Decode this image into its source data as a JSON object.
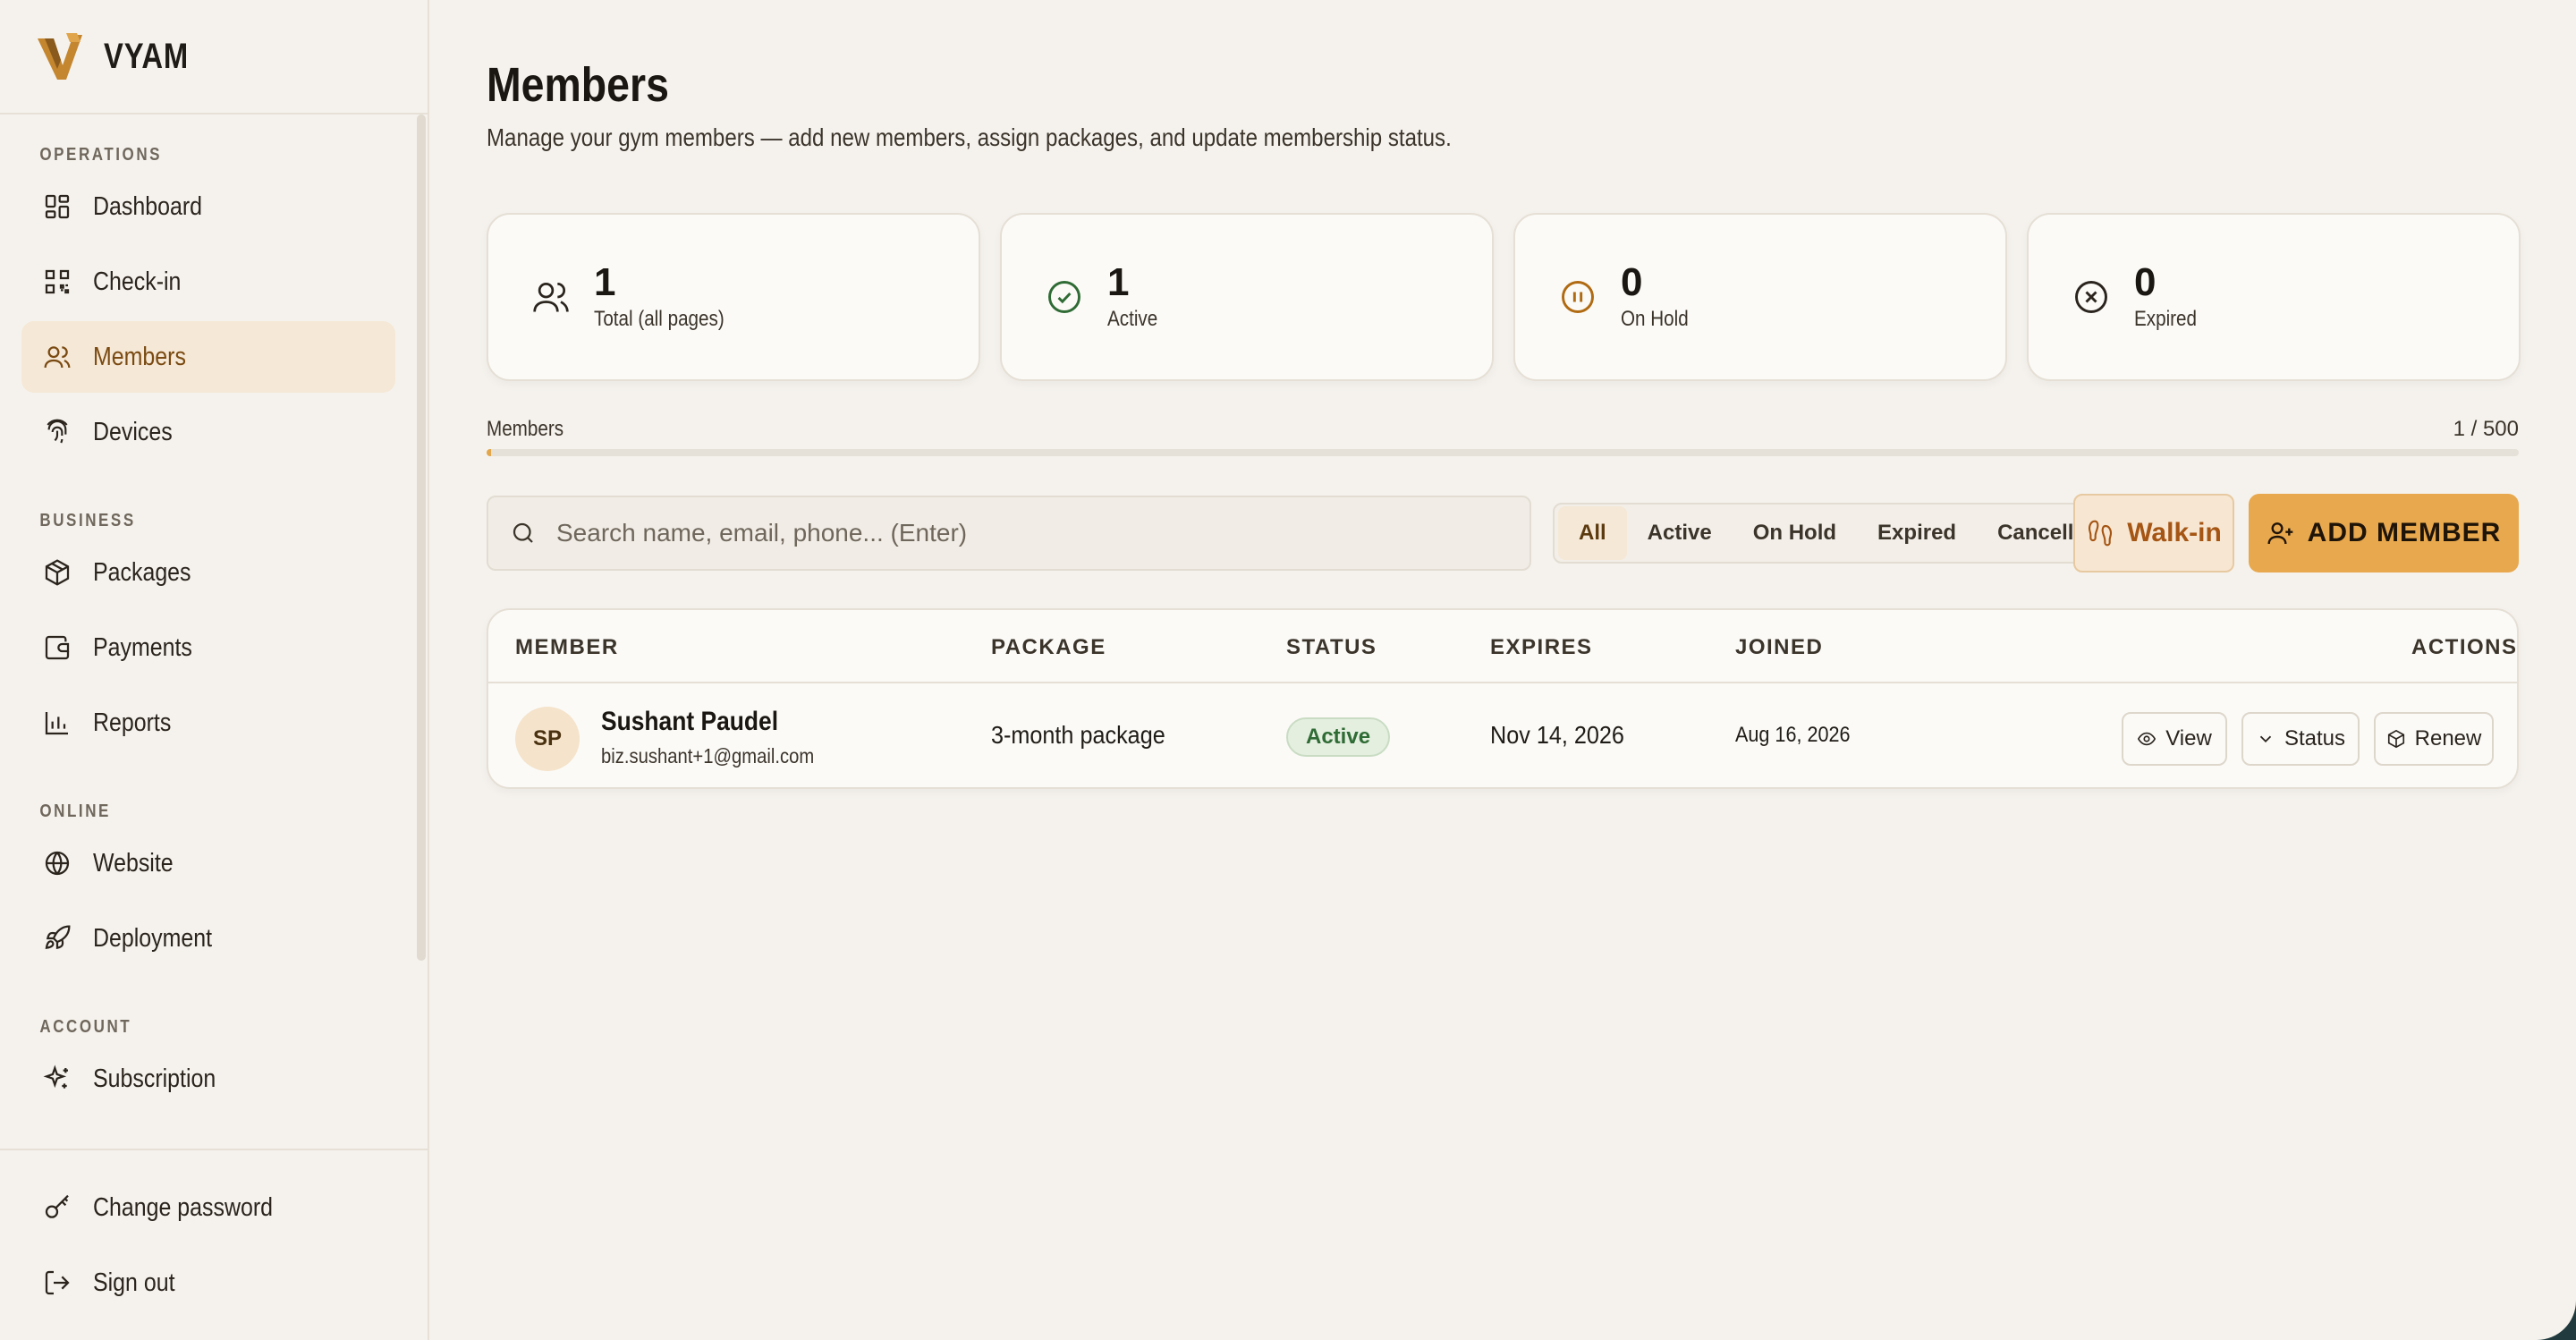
{
  "brand": {
    "name": "VYAM"
  },
  "sidebar": {
    "sections": [
      {
        "label": "OPERATIONS",
        "items": [
          {
            "label": "Dashboard",
            "icon": "dashboard-icon"
          },
          {
            "label": "Check-in",
            "icon": "qr-code-icon"
          },
          {
            "label": "Members",
            "icon": "users-icon",
            "active": true
          },
          {
            "label": "Devices",
            "icon": "fingerprint-icon"
          }
        ]
      },
      {
        "label": "BUSINESS",
        "items": [
          {
            "label": "Packages",
            "icon": "package-icon"
          },
          {
            "label": "Payments",
            "icon": "wallet-icon"
          },
          {
            "label": "Reports",
            "icon": "bar-chart-icon"
          }
        ]
      },
      {
        "label": "ONLINE",
        "items": [
          {
            "label": "Website",
            "icon": "globe-icon"
          },
          {
            "label": "Deployment",
            "icon": "rocket-icon"
          }
        ]
      },
      {
        "label": "ACCOUNT",
        "items": [
          {
            "label": "Subscription",
            "icon": "sparkles-icon"
          }
        ]
      }
    ],
    "bottom": [
      {
        "label": "Change password",
        "icon": "key-icon"
      },
      {
        "label": "Sign out",
        "icon": "sign-out-icon"
      }
    ]
  },
  "header": {
    "title": "Members",
    "subtitle": "Manage your gym members — add new members, assign packages, and update membership status."
  },
  "stats": [
    {
      "value": "1",
      "label": "Total (all pages)",
      "icon": "users-icon"
    },
    {
      "value": "1",
      "label": "Active",
      "icon": "check-circle-icon"
    },
    {
      "value": "0",
      "label": "On Hold",
      "icon": "pause-circle-icon"
    },
    {
      "value": "0",
      "label": "Expired",
      "icon": "x-circle-icon"
    }
  ],
  "usage": {
    "label": "Members",
    "count": "1 / 500",
    "fraction": 0.002
  },
  "search": {
    "placeholder": "Search name, email, phone... (Enter)",
    "value": ""
  },
  "filters": [
    "All",
    "Active",
    "On Hold",
    "Expired",
    "Cancelled"
  ],
  "buttons": {
    "walkin": "Walk-in",
    "add_member": "ADD MEMBER"
  },
  "table": {
    "columns": [
      "MEMBER",
      "PACKAGE",
      "STATUS",
      "EXPIRES",
      "JOINED",
      "ACTIONS"
    ],
    "rows": [
      {
        "initials": "SP",
        "name": "Sushant Paudel",
        "email": "biz.sushant+1@gmail.com",
        "package": "3-month package",
        "status": "Active",
        "expires": "Nov 14, 2026",
        "joined": "Aug 16, 2026",
        "actions": [
          "View",
          "Status",
          "Renew"
        ]
      }
    ]
  },
  "colors": {
    "accent": "#e8a84d",
    "active_nav_bg": "#f5e8d6",
    "status_active": "#2f6b34",
    "on_hold": "#b06a12"
  }
}
